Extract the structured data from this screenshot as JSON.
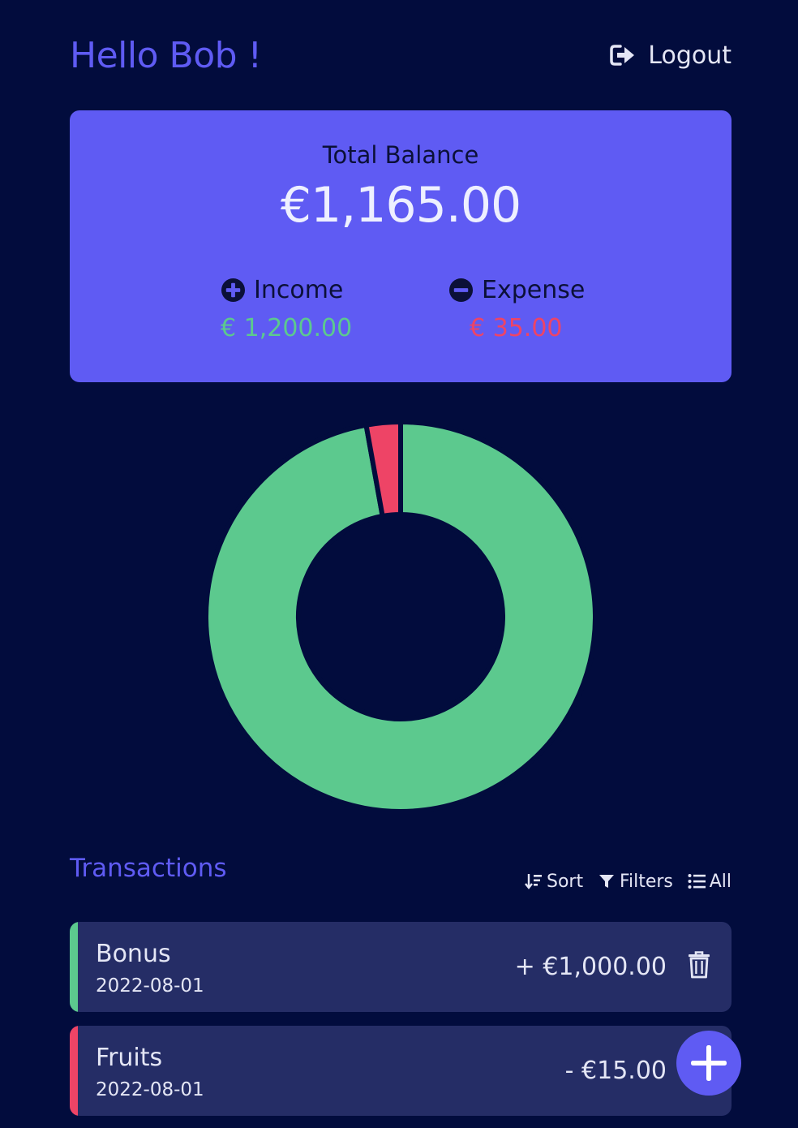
{
  "header": {
    "greeting": "Hello Bob !",
    "logout_label": "Logout"
  },
  "balance": {
    "label": "Total Balance",
    "amount": "€1,165.00",
    "income": {
      "label": "Income",
      "value": "€ 1,200.00"
    },
    "expense": {
      "label": "Expense",
      "value": "€ 35.00"
    }
  },
  "colors": {
    "background": "#020c3d",
    "accent": "#5f5bf3",
    "card": "#252d66",
    "income": "#5cc98e",
    "expense": "#ee4466"
  },
  "chart_data": {
    "type": "pie",
    "donut": true,
    "labels": [
      "Income",
      "Expense"
    ],
    "values": [
      1200,
      35
    ],
    "colors": [
      "#5cc98e",
      "#ee4466"
    ]
  },
  "transactions": {
    "title": "Transactions",
    "tools": {
      "sort": "Sort",
      "filters": "Filters",
      "all": "All"
    },
    "items": [
      {
        "name": "Bonus",
        "date": "2022-08-01",
        "amount": "+ €1,000.00",
        "kind": "income"
      },
      {
        "name": "Fruits",
        "date": "2022-08-01",
        "amount": "- €15.00",
        "kind": "expense"
      }
    ]
  },
  "icons": {
    "logout": "logout-icon",
    "income": "plus-circle-icon",
    "expense": "minus-circle-icon",
    "sort": "sort-icon",
    "filters": "filter-icon",
    "all": "list-icon",
    "delete": "trash-icon",
    "fab": "plus-icon"
  }
}
